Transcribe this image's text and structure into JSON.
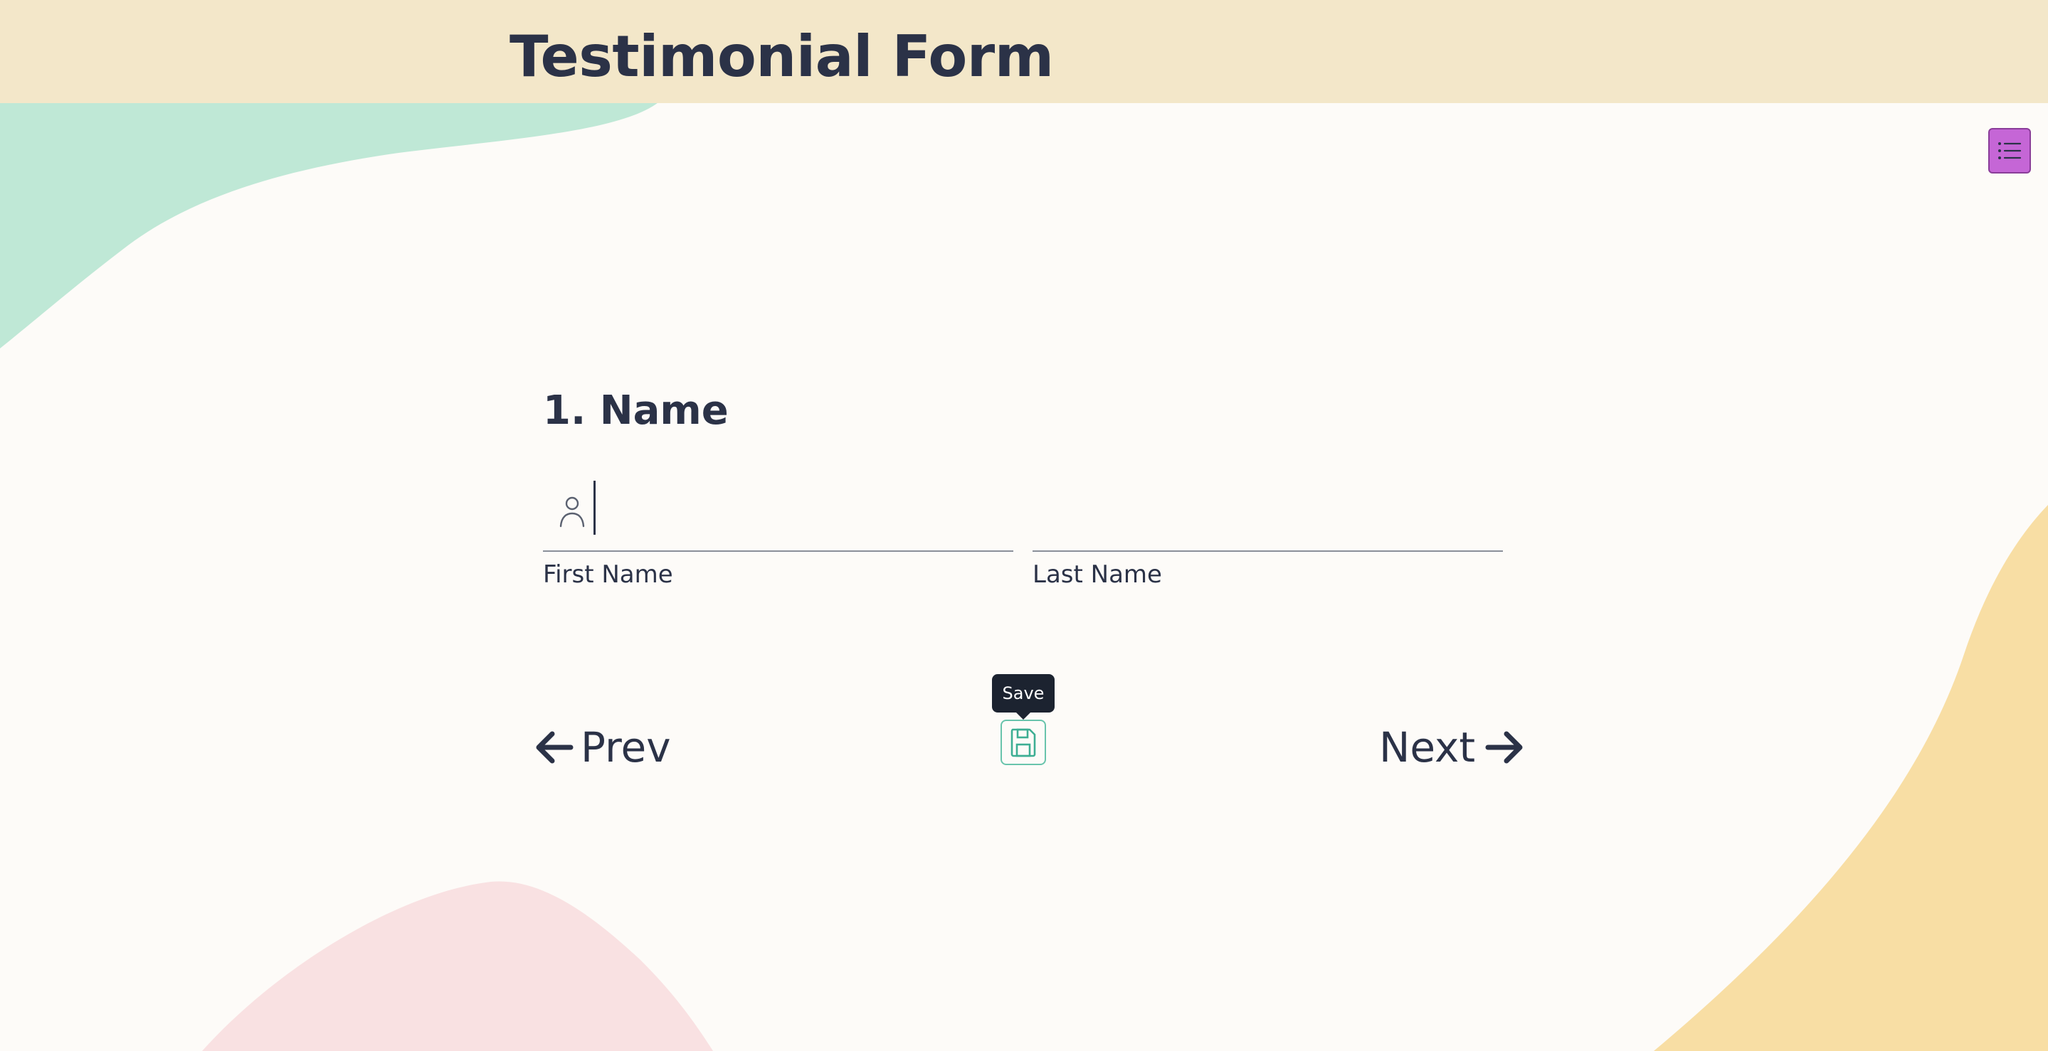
{
  "header": {
    "title": "Testimonial Form"
  },
  "menu": {
    "icon": "list-icon",
    "color": "#c566d6"
  },
  "question": {
    "title": "1. Name",
    "fields": [
      {
        "label": "First Name",
        "value": "",
        "icon": "person-icon"
      },
      {
        "label": "Last Name",
        "value": ""
      }
    ]
  },
  "navigation": {
    "prev_label": "Prev",
    "next_label": "Next",
    "save_tooltip": "Save",
    "save_icon": "floppy-disk-icon"
  },
  "colors": {
    "header_bg": "#f3e7c9",
    "page_bg": "#fdfbf8",
    "text": "#2b3247",
    "accent_teal": "#69c4ac",
    "blob_green": "#bfe8d6",
    "blob_pink": "#f9e1e2",
    "blob_yellow": "#f8dea4"
  }
}
